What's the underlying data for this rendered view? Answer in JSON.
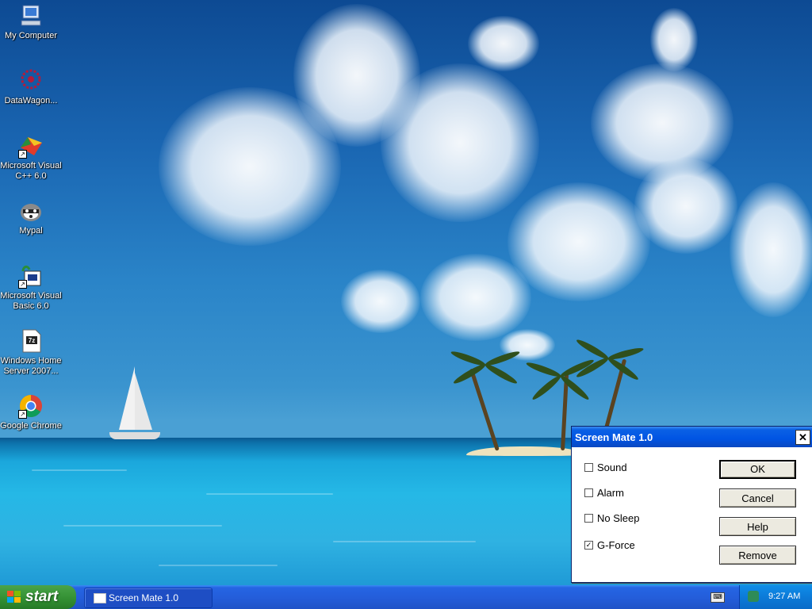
{
  "desktop": {
    "icons": [
      {
        "label": "My Computer",
        "icon": "my-computer-icon"
      },
      {
        "label": "DataWagon...",
        "icon": "datawagon-icon"
      },
      {
        "label": "Microsoft Visual C++ 6.0",
        "icon": "visual-cpp-icon"
      },
      {
        "label": "Mypal",
        "icon": "mypal-icon"
      },
      {
        "label": "Microsoft Visual Basic 6.0",
        "icon": "visual-basic-icon"
      },
      {
        "label": "Windows Home Server 2007...",
        "icon": "7z-file-icon"
      },
      {
        "label": "Google Chrome",
        "icon": "chrome-icon"
      }
    ]
  },
  "dialog": {
    "title": "Screen Mate 1.0",
    "close_label": "✕",
    "checkboxes": [
      {
        "label": "Sound",
        "checked": false
      },
      {
        "label": "Alarm",
        "checked": false
      },
      {
        "label": "No Sleep",
        "checked": false
      },
      {
        "label": "G-Force",
        "checked": true
      }
    ],
    "buttons": {
      "ok": "OK",
      "cancel": "Cancel",
      "help": "Help",
      "remove": "Remove"
    }
  },
  "taskbar": {
    "start_label": "start",
    "task_label": "Screen Mate 1.0",
    "clock": "9:27 AM"
  }
}
